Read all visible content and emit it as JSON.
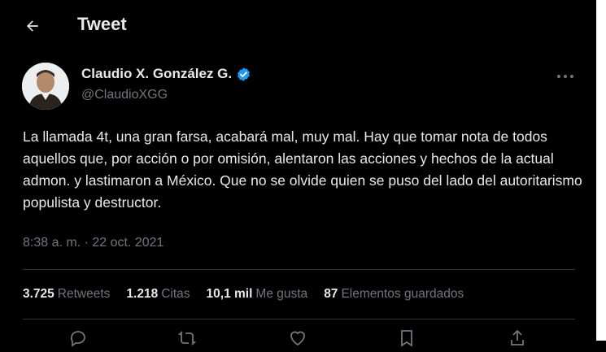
{
  "header": {
    "title": "Tweet",
    "back_icon": "arrow-left-icon"
  },
  "author": {
    "name": "Claudio X. González G.",
    "handle": "@ClaudioXGG",
    "verified_icon": "verified-badge-icon",
    "verified_color": "#1d9bf0"
  },
  "tweet": {
    "text": "La llamada 4t, una gran farsa, acabará mal, muy mal. Hay que tomar nota de todos aquellos que, por acción o por omisión, alentaron las acciones y hechos de la actual admon. y lastimaron a México. Que no se olvide quien se puso del lado del autoritarismo populista y destructor.",
    "timestamp": "8:38 a. m. · 22 oct. 2021"
  },
  "stats": [
    {
      "value": "3.725",
      "label": "Retweets"
    },
    {
      "value": "1.218",
      "label": "Citas"
    },
    {
      "value": "10,1 mil",
      "label": "Me gusta"
    },
    {
      "value": "87",
      "label": "Elementos guardados"
    }
  ],
  "actions": [
    "reply-icon",
    "retweet-icon",
    "like-icon",
    "bookmark-icon",
    "share-icon"
  ],
  "colors": {
    "background": "#000000",
    "text": "#e7e9ea",
    "muted": "#71767b",
    "divider": "#2f3336"
  }
}
